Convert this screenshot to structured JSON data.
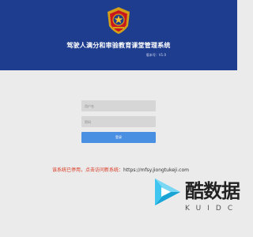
{
  "header": {
    "title": "驾驶人满分和审验教育课堂管理系统",
    "version": "版本号：V1.0",
    "emblem_icon": "police-emblem-icon",
    "background_color": "#1e3d8f"
  },
  "login": {
    "username_placeholder": "用户名",
    "password_placeholder": "密码",
    "login_button": "登录",
    "button_color": "#4a90e2"
  },
  "notice": {
    "text": "该系统已停用，点击访问新系统：",
    "link_text": "https://mfsy.jiongtukeji.com",
    "text_color": "#d9361e"
  },
  "watermark": {
    "main_text": "酷数据",
    "sub_text": "KUIDC",
    "logo_icon": "play-triangle-logo-icon"
  }
}
